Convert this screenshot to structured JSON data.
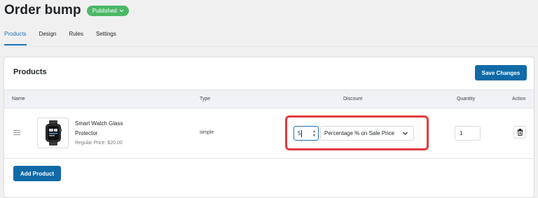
{
  "header": {
    "title": "Order bump",
    "status": "Published"
  },
  "tabs": [
    {
      "label": "Products",
      "active": true
    },
    {
      "label": "Design",
      "active": false
    },
    {
      "label": "Rules",
      "active": false
    },
    {
      "label": "Settings",
      "active": false
    }
  ],
  "card": {
    "title": "Products",
    "save_label": "Save Changes",
    "columns": {
      "name": "Name",
      "type": "Type",
      "discount": "Discount",
      "quantity": "Quantity",
      "action": "Action"
    },
    "rows": [
      {
        "name": "Smart Watch Glass Protector",
        "price": "Regular Price: $20.00",
        "type": "simple",
        "discount_value": "5",
        "discount_type": "Percentage % on Sale Price",
        "quantity": "1"
      }
    ],
    "add_label": "Add Product"
  },
  "colors": {
    "accent": "#0f6aa7",
    "badge": "#4ab866",
    "highlight": "#e13c3c"
  },
  "icons": [
    "chevron-down-icon",
    "drag-handle-icon",
    "trash-icon",
    "spinner-icon"
  ]
}
